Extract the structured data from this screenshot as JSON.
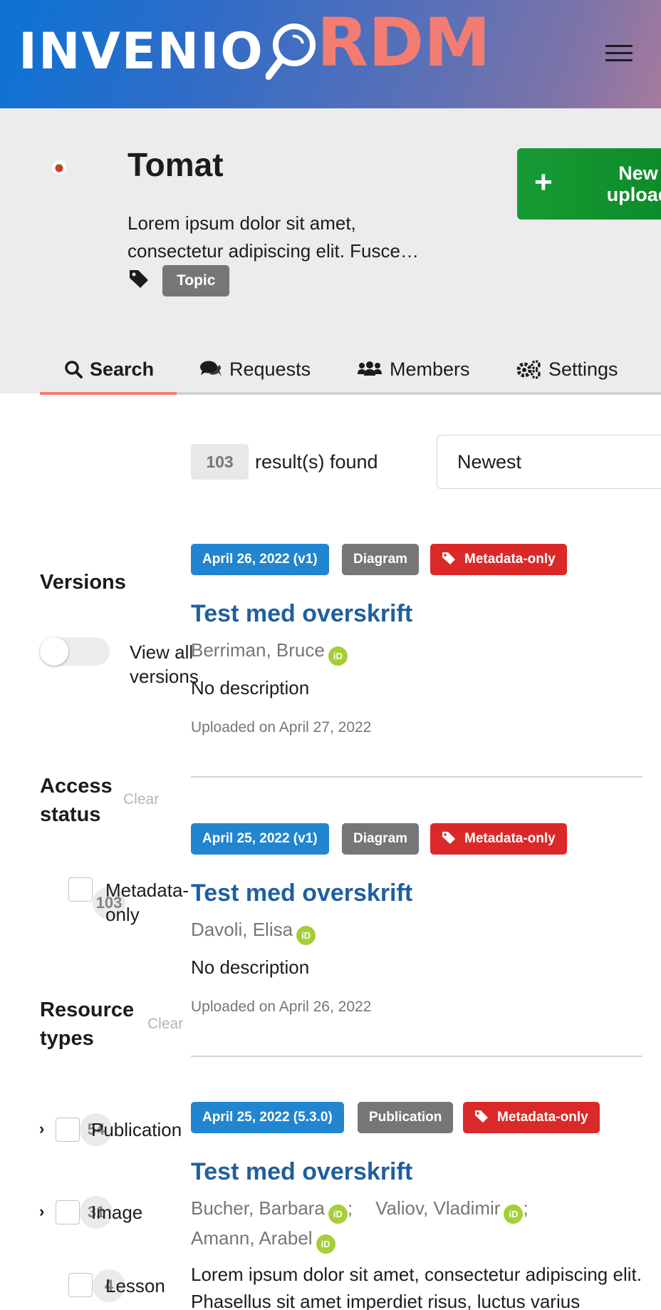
{
  "header": {
    "logo_primary": "INVENIO",
    "logo_secondary": "RDM",
    "menu_icon": "hamburger-icon"
  },
  "community": {
    "title": "Tomat",
    "description": "Lorem ipsum dolor sit amet, consectetur adipiscing elit. Fusce…",
    "topic_label": "Topic",
    "new_upload_label": "New upload"
  },
  "tabs": [
    {
      "label": "Search",
      "icon": "search-icon",
      "active": true
    },
    {
      "label": "Requests",
      "icon": "comments-icon",
      "active": false
    },
    {
      "label": "Members",
      "icon": "users-icon",
      "active": false
    },
    {
      "label": "Settings",
      "icon": "cogs-icon",
      "active": false
    }
  ],
  "results": {
    "count": "103",
    "found_label": "result(s) found",
    "sort_value": "Newest"
  },
  "facets": {
    "versions": {
      "title": "Versions",
      "toggle_label": "View all versions",
      "toggle_on": false
    },
    "access_status": {
      "title": "Access status",
      "clear_label": "Clear",
      "options": [
        {
          "label": "Metadata-only",
          "count": "103"
        }
      ]
    },
    "resource_types": {
      "title": "Resource types",
      "clear_label": "Clear",
      "options": [
        {
          "label": "Publication",
          "count": "54"
        },
        {
          "label": "Image",
          "count": "31"
        },
        {
          "label": "Lesson",
          "count": "4"
        }
      ]
    }
  },
  "items": [
    {
      "date_badge": "April 26, 2022 (v1)",
      "type_badge": "Diagram",
      "access_badge": "Metadata-only",
      "title": "Test med overskrift",
      "authors": [
        "Berriman, Bruce"
      ],
      "description": "No description",
      "uploaded": "Uploaded on April 27, 2022"
    },
    {
      "date_badge": "April 25, 2022 (v1)",
      "type_badge": "Diagram",
      "access_badge": "Metadata-only",
      "title": "Test med overskrift",
      "authors": [
        "Davoli, Elisa"
      ],
      "description": "No description",
      "uploaded": "Uploaded on April 26, 2022"
    },
    {
      "date_badge": "April 25, 2022 (5.3.0)",
      "type_badge": "Publication",
      "access_badge": "Metadata-only",
      "title": "Test med overskrift",
      "authors": [
        "Bucher, Barbara",
        "Valiov, Vladimir",
        "Amann, Arabel"
      ],
      "description": "Lorem ipsum dolor sit amet, consectetur adipiscing elit. Phasellus sit amet imperdiet risus, luctus varius"
    }
  ],
  "orcid_label": "iD",
  "author_separator": ";",
  "colors": {
    "brand_accent": "#f27c71",
    "link": "#1f5f9f",
    "date_badge": "#2185d0",
    "access_badge": "#db2828",
    "new_upload": "#179a33",
    "orcid": "#a6ce39"
  }
}
